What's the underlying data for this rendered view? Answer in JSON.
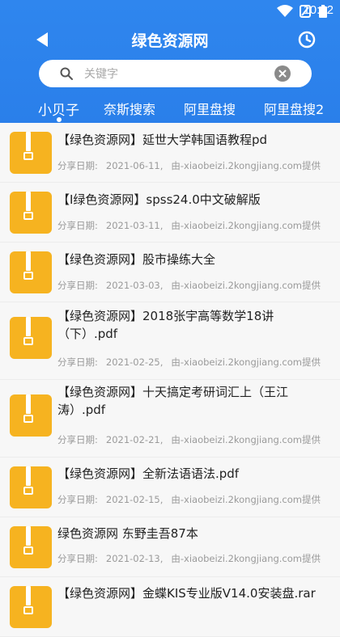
{
  "status_bar": {
    "time": "10:32"
  },
  "header": {
    "title": "绿色资源网",
    "back_icon": "back-arrow-icon",
    "history_icon": "clock-icon",
    "background": "#2f86ee"
  },
  "search": {
    "placeholder": "关键字",
    "value": ""
  },
  "tabs": [
    {
      "label": "小贝子"
    },
    {
      "label": "奈斯搜索"
    },
    {
      "label": "阿里盘搜"
    },
    {
      "label": "阿里盘搜2"
    }
  ],
  "items": [
    {
      "title": "【绿色资源网】延世大学韩国语教程pd",
      "date_label": "分享日期:",
      "date": "2021-06-11,",
      "source": "由-xiaobeizi.2kongjiang.com提供"
    },
    {
      "title": "【I绿色资源网】spss24.0中文破解版",
      "date_label": "分享日期:",
      "date": "2021-03-11,",
      "source": "由-xiaobeizi.2kongjiang.com提供"
    },
    {
      "title": "【绿色资源网】股市操练大全",
      "date_label": "分享日期:",
      "date": "2021-03-03,",
      "source": "由-xiaobeizi.2kongjiang.com提供"
    },
    {
      "title": "【绿色资源网】2018张宇高等数学18讲（下）.pdf",
      "date_label": "分享日期:",
      "date": "2021-02-25,",
      "source": "由-xiaobeizi.2kongjiang.com提供"
    },
    {
      "title": "【绿色资源网】十天搞定考研词汇上（王江涛）.pdf",
      "date_label": "分享日期:",
      "date": "2021-02-21,",
      "source": "由-xiaobeizi.2kongjiang.com提供"
    },
    {
      "title": "【绿色资源网】全新法语语法.pdf",
      "date_label": "分享日期:",
      "date": "2021-02-15,",
      "source": "由-xiaobeizi.2kongjiang.com提供"
    },
    {
      "title": "绿色资源网 东野圭吾87本",
      "date_label": "分享日期:",
      "date": "2021-02-13,",
      "source": "由-xiaobeizi.2kongjiang.com提供"
    },
    {
      "title": "【绿色资源网】金蝶KIS专业版V14.0安装盘.rar",
      "date_label": "",
      "date": "",
      "source": ""
    }
  ],
  "colors": {
    "accent": "#2f86ee",
    "zip_icon": "#f6b320"
  }
}
